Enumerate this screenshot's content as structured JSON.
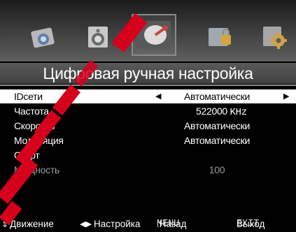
{
  "categories": [
    {
      "name": "picture",
      "icon": "picture-icon"
    },
    {
      "name": "sound",
      "icon": "speaker-icon"
    },
    {
      "name": "channel",
      "icon": "satellite-dish-icon",
      "selected": true
    },
    {
      "name": "lock",
      "icon": "lock-icon"
    },
    {
      "name": "setup",
      "icon": "gear-icon"
    }
  ],
  "title": "Цифровая ручная настройка",
  "menu": {
    "rows": [
      {
        "label": "IDсети",
        "value": "Автоматически",
        "selected": true
      },
      {
        "label": "Частота",
        "value": "522000",
        "unit": "KHz"
      },
      {
        "label": "Скорость",
        "value": "Автоматически"
      },
      {
        "label": "Модуляция",
        "value": "Автоматически"
      },
      {
        "label": "Старт",
        "value": ""
      },
      {
        "label": "Мощность",
        "value": "100",
        "dim": true
      }
    ]
  },
  "footer": {
    "move_label": "Движение",
    "adjust_label": "Настройка",
    "menu_key": "MENU",
    "menu_label": ":Назад",
    "exit_key": "EXIT",
    "exit_label": "Выход"
  },
  "colors": {
    "background": "#000000",
    "selected_row": "#ffffff",
    "watermark": "#d5001c"
  }
}
